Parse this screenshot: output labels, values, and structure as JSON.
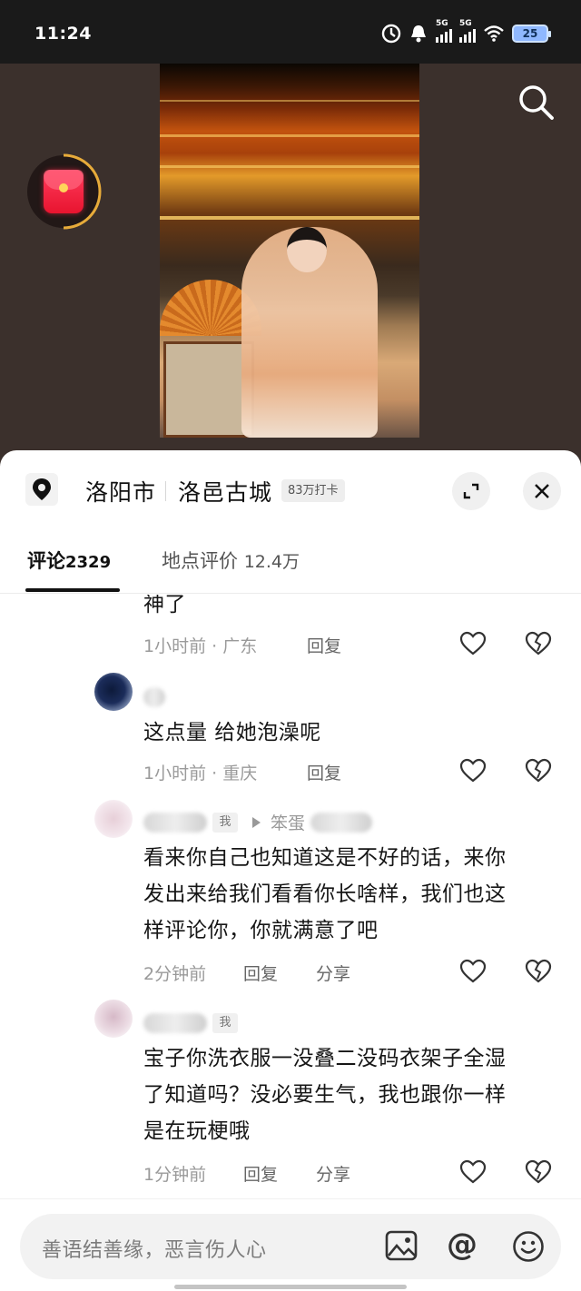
{
  "status_bar": {
    "time": "11:24",
    "signal1_label": "5G",
    "signal2_label": "5G",
    "battery": "25"
  },
  "location": {
    "city": "洛阳市",
    "place": "洛邑古城",
    "checkin": "83万打卡"
  },
  "tabs": {
    "comments": {
      "label": "评论",
      "count": "2329"
    },
    "reviews": {
      "label": "地点评价",
      "count": "12.4万"
    }
  },
  "comments": [
    {
      "text": "神了",
      "time": "1小时前 · 广东",
      "reply": "回复"
    },
    {
      "text": "这点量 给她泡澡呢",
      "time": "1小时前 · 重庆",
      "reply": "回复"
    },
    {
      "me": "我",
      "reply_to": "笨蛋",
      "text": "看来你自己也知道这是不好的话，来你\n发出来给我们看看你长啥样，我们也这\n样评论你，你就满意了吧",
      "time": "2分钟前",
      "reply": "回复",
      "share": "分享"
    },
    {
      "me": "我",
      "text": "宝子你洗衣服一没叠二没码衣架子全湿\n了知道吗？没必要生气，我也跟你一样\n是在玩梗哦",
      "time": "1分钟前",
      "reply": "回复",
      "share": "分享"
    }
  ],
  "input": {
    "placeholder": "善语结善缘，恶言伤人心",
    "at": "@"
  },
  "icons": [
    "search-icon",
    "red-packet-icon",
    "location-pin-icon",
    "expand-icon",
    "close-icon",
    "heart-icon",
    "broken-heart-icon",
    "image-icon",
    "at-icon",
    "emoji-icon"
  ]
}
